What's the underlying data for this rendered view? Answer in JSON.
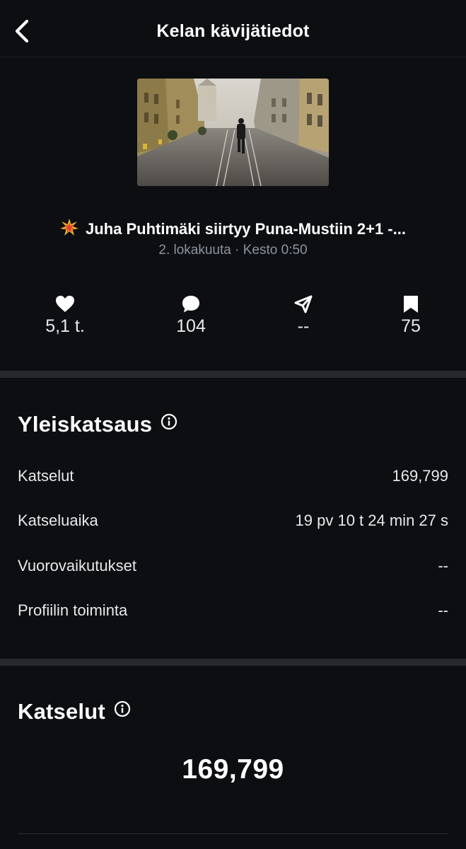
{
  "header": {
    "title": "Kelan kävijätiedot",
    "back_icon": "chevron-left-icon"
  },
  "video": {
    "title": "Juha Puhtimäki siirtyy Puna-Mustiin 2+1 -...",
    "title_icon": "collision-emoji",
    "date": "2. lokakuuta",
    "separator": "·",
    "duration_label": "Kesto",
    "duration": "0:50"
  },
  "stats": [
    {
      "icon": "heart-icon",
      "value": "5,1 t."
    },
    {
      "icon": "comment-icon",
      "value": "104"
    },
    {
      "icon": "share-icon",
      "value": "--"
    },
    {
      "icon": "bookmark-icon",
      "value": "75"
    }
  ],
  "overview": {
    "title": "Yleiskatsaus",
    "rows": [
      {
        "label": "Katselut",
        "value": "169,799"
      },
      {
        "label": "Katseluaika",
        "value": "19 pv 10 t 24 min 27 s"
      },
      {
        "label": "Vuorovaikutukset",
        "value": "--"
      },
      {
        "label": "Profiilin toiminta",
        "value": "--"
      }
    ]
  },
  "views": {
    "title": "Katselut",
    "total": "169,799"
  },
  "colors": {
    "background": "#0c0e12",
    "divider": "#25282d",
    "text_primary": "#ffffff",
    "text_secondary": "#8b949e"
  }
}
